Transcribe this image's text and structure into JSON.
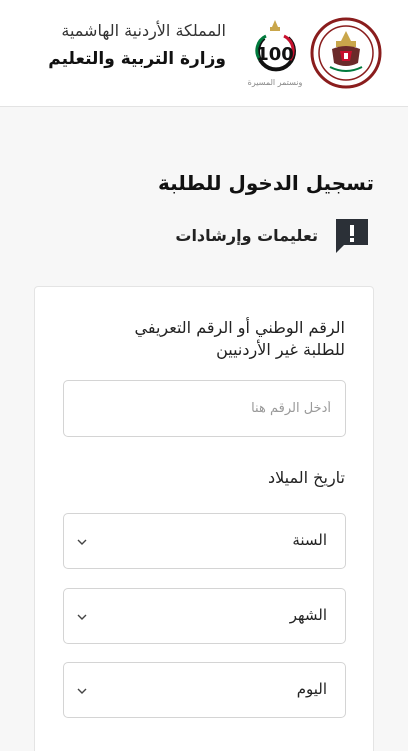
{
  "header": {
    "kingdom": "المملكة الأردنية الهاشمية",
    "ministry": "وزارة التربية والتعليم",
    "centennial_number": "100",
    "centennial_caption": "ونستمر المسيرة"
  },
  "page": {
    "title": "تسجيل الدخول للطلبة",
    "instructions_label": "تعليمات وإرشادات"
  },
  "form": {
    "id_label_line1": "الرقم الوطني أو الرقم التعريفي",
    "id_label_line2": "للطلبة غير الأردنيين",
    "id_placeholder": "أدخل الرقم هنا",
    "dob_label": "تاريخ الميلاد",
    "year_selected": "السنة",
    "month_selected": "الشهر",
    "day_selected": "اليوم"
  },
  "colors": {
    "icon_dark": "#2b3037",
    "logo_red": "#c8102e",
    "logo_green": "#007a3d",
    "logo_gold": "#c9a64b"
  },
  "icons": {
    "instructions": "exclamation-speech-bubble-icon",
    "select_arrow": "chevron-down-icon"
  }
}
